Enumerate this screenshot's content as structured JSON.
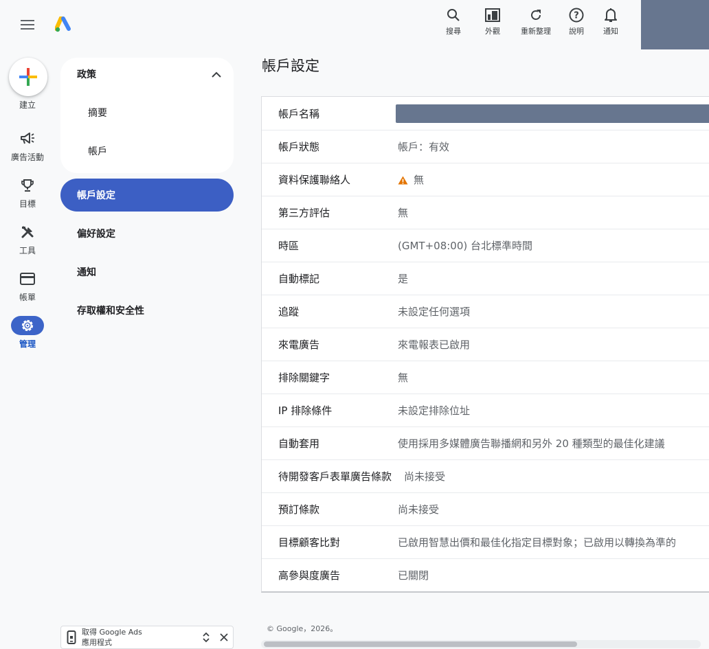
{
  "top_actions": [
    {
      "label": "搜尋",
      "icon": "search-icon"
    },
    {
      "label": "外觀",
      "icon": "appearance-icon"
    },
    {
      "label": "重新整理",
      "icon": "refresh-icon"
    },
    {
      "label": "說明",
      "icon": "help-icon"
    },
    {
      "label": "通知",
      "icon": "bell-icon"
    }
  ],
  "create_label": "建立",
  "rail": [
    {
      "label": "廣告活動",
      "icon": "megaphone-icon"
    },
    {
      "label": "目標",
      "icon": "trophy-icon"
    },
    {
      "label": "工具",
      "icon": "tools-icon"
    },
    {
      "label": "帳單",
      "icon": "credit-card-icon"
    },
    {
      "label": "管理",
      "icon": "gear-icon",
      "active": true
    }
  ],
  "nav": {
    "section": "政策",
    "sub_items": [
      "摘要",
      "帳戶"
    ],
    "items": [
      "帳戶設定",
      "偏好設定",
      "通知",
      "存取權和安全性"
    ]
  },
  "page_title": "帳戶設定",
  "settings": [
    {
      "label": "帳戶名稱",
      "value": ""
    },
    {
      "label": "帳戶狀態",
      "value": "帳戶：有效"
    },
    {
      "label": "資料保護聯絡人",
      "value": "無"
    },
    {
      "label": "第三方評估",
      "value": "無"
    },
    {
      "label": "時區",
      "value": "(GMT+08:00) 台北標準時間"
    },
    {
      "label": "自動標記",
      "value": "是"
    },
    {
      "label": "追蹤",
      "value": "未設定任何選項"
    },
    {
      "label": "來電廣告",
      "value": "來電報表已啟用"
    },
    {
      "label": "排除關鍵字",
      "value": "無"
    },
    {
      "label": "IP 排除條件",
      "value": "未設定排除位址"
    },
    {
      "label": "自動套用",
      "value": "使用採用多媒體廣告聯播網和另外 20 種類型的最佳化建議"
    },
    {
      "label": "待開發客戶表單廣告條款",
      "value": "尚未接受"
    },
    {
      "label": "預訂條款",
      "value": "尚未接受"
    },
    {
      "label": "目標顧客比對",
      "value": "已啟用智慧出價和最佳化指定目標對象；已啟用以轉換為準的"
    },
    {
      "label": "高參與度廣告",
      "value": "已關閉"
    }
  ],
  "footer": "© Google，2026。",
  "app_banner": {
    "line1": "取得 Google Ads",
    "line2": "應用程式"
  },
  "colors": {
    "primary": "#3c5fc4",
    "redacted": "#67768f",
    "warning": "#e37400"
  }
}
